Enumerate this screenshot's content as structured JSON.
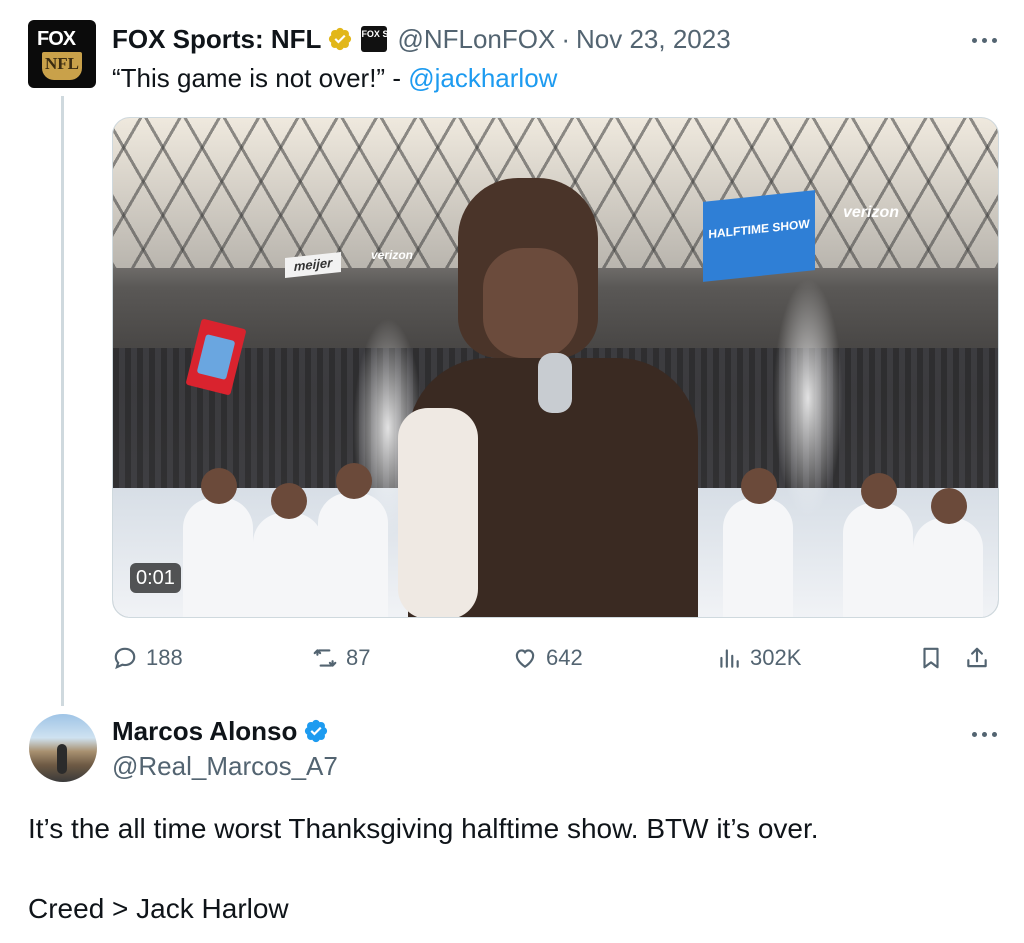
{
  "parent_tweet": {
    "author_name": "FOX Sports: NFL",
    "handle": "@NFLonFOX",
    "separator": "·",
    "date": "Nov 23, 2023",
    "text_prefix": "“This game is not over!” - ",
    "mention": "@jackharlow",
    "avatar": {
      "top_text": "FOX",
      "bottom_text": "NFL"
    },
    "affiliate_badge_text": "FOX SPORTS",
    "video": {
      "timestamp": "0:01",
      "visible_signs": {
        "meijer": "meijer",
        "verizon": "verizon",
        "screen": "HALFTIME SHOW"
      }
    },
    "metrics": {
      "replies": "188",
      "retweets": "87",
      "likes": "642",
      "views": "302K"
    },
    "icons": [
      "reply-icon",
      "retweet-icon",
      "like-icon",
      "views-icon",
      "bookmark-icon",
      "share-icon",
      "more-icon",
      "verified-gold-icon"
    ]
  },
  "reply_tweet": {
    "author_name": "Marcos Alonso",
    "handle": "@Real_Marcos_A7",
    "text_line1": "It’s the all time worst Thanksgiving halftime show. BTW it’s over.",
    "text_line2": "Creed > Jack Harlow",
    "icons": [
      "verified-blue-icon",
      "more-icon"
    ]
  },
  "colors": {
    "text_primary": "#0f1419",
    "text_secondary": "#536471",
    "link_blue": "#1d9bf0",
    "verified_gold": "#e2b719",
    "verified_blue": "#1d9bf0",
    "thread_line": "#cfd9de"
  }
}
